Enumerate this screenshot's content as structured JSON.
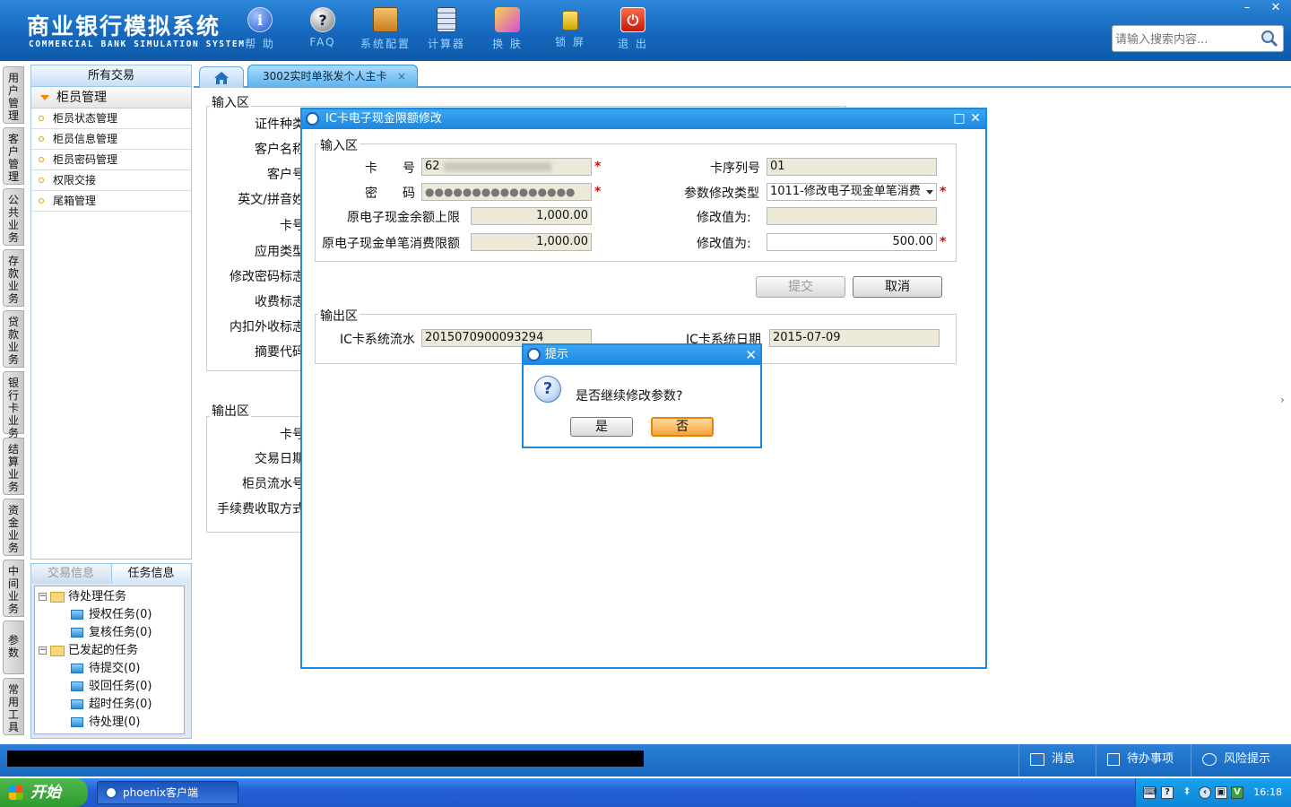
{
  "header": {
    "title_cn": "商业银行模拟系统",
    "title_en": "COMMERCIAL BANK SIMULATION SYSTEM",
    "toolbar": [
      {
        "label": "帮 助",
        "icon": "info-icon",
        "glyph": "i"
      },
      {
        "label": "FAQ",
        "icon": "help-icon",
        "glyph": "?"
      },
      {
        "label": "系统配置",
        "icon": "toolbox-icon",
        "glyph": ""
      },
      {
        "label": "计算器",
        "icon": "calculator-icon",
        "glyph": ""
      },
      {
        "label": "换 肤",
        "icon": "shirt-icon",
        "glyph": ""
      },
      {
        "label": "锁 屏",
        "icon": "lock-icon",
        "glyph": ""
      },
      {
        "label": "退 出",
        "icon": "power-icon",
        "glyph": ""
      }
    ],
    "search_placeholder": "请输入搜索内容..."
  },
  "vertical_tabs": [
    "用户管理",
    "客户管理",
    "公共业务",
    "存款业务",
    "贷款业务",
    "银行卡业务",
    "结算业务",
    "资金业务",
    "中间业务",
    "参数",
    "常用工具"
  ],
  "nav": {
    "title": "所有交易",
    "group": "柜员管理",
    "items": [
      "柜员状态管理",
      "柜员信息管理",
      "柜员密码管理",
      "权限交接",
      "尾箱管理"
    ]
  },
  "task_panel": {
    "tabs": [
      "交易信息",
      "任务信息"
    ],
    "tree": [
      {
        "label": "待处理任务",
        "level": 0
      },
      {
        "label": "授权任务(0)",
        "level": 1
      },
      {
        "label": "复核任务(0)",
        "level": 1
      },
      {
        "label": "已发起的任务",
        "level": 0
      },
      {
        "label": "待提交(0)",
        "level": 1
      },
      {
        "label": "驳回任务(0)",
        "level": 1
      },
      {
        "label": "超时任务(0)",
        "level": 1
      },
      {
        "label": "待处理(0)",
        "level": 1
      }
    ]
  },
  "tabs": {
    "active": "3002实时单张发个人主卡",
    "close": "×"
  },
  "background_form": {
    "input_section": "输入区",
    "input_labels": [
      "证件种类",
      "客户名称",
      "客户号",
      "英文/拼音姓",
      "卡号",
      "应用类型",
      "修改密码标志",
      "收费标志",
      "内扣外收标志",
      "摘要代码"
    ],
    "output_section": "输出区",
    "output_labels": [
      "卡号",
      "交易日期",
      "柜员流水号",
      "手续费收取方式"
    ]
  },
  "dialog": {
    "title": "IC卡电子现金限额修改",
    "input_section": "输入区",
    "card_no_label": "卡　　号",
    "card_no_value": "62",
    "card_seq_label": "卡序列号",
    "card_seq_value": "01",
    "password_label": "密　　码",
    "password_value": "●●●●●●●●●●●●●●●●",
    "param_type_label": "参数修改类型",
    "param_type_value": "1011-修改电子现金单笔消费",
    "balance_limit_label": "原电子现金余额上限",
    "balance_limit_value": "1,000.00",
    "modify_value_label_1": "修改值为:",
    "modify_value_1": "",
    "single_limit_label": "原电子现金单笔消费限额",
    "single_limit_value": "1,000.00",
    "modify_value_label_2": "修改值为:",
    "modify_value_2": "500.00",
    "submit_label": "提交",
    "cancel_label": "取消",
    "output_section": "输出区",
    "ic_serial_label": "IC卡系统流水",
    "ic_serial_value": "2015070900093294",
    "ic_date_label": "IC卡系统日期",
    "ic_date_value": "2015-07-09",
    "required_mark": "*"
  },
  "popup": {
    "title": "提示",
    "message": "是否继续修改参数?",
    "yes_label": "是",
    "no_label": "否"
  },
  "statusbar": {
    "messages_label": "消息",
    "todo_label": "待办事项",
    "risk_label": "风险提示"
  },
  "taskbar": {
    "start_label": "开始",
    "app_label": "phoenix客户端",
    "clock": "16:18"
  }
}
